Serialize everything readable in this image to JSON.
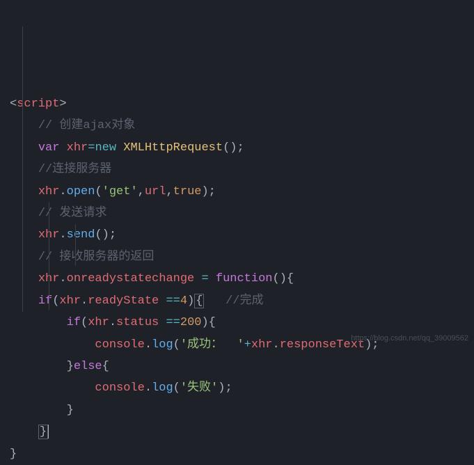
{
  "code": {
    "l1": {
      "open": "<",
      "tag": "script",
      "close": ">"
    },
    "l2": "// 创建ajax对象",
    "l3": {
      "kw": "var",
      "name": "xhr",
      "eq": "=",
      "new": "new",
      "cls": "XMLHttpRequest",
      "paren": "();"
    },
    "l4": "//连接服务器",
    "l5": {
      "obj": "xhr",
      "dot": ".",
      "m": "open",
      "p1": "(",
      "s1": "'get'",
      "c1": ",",
      "a2": "url",
      "c2": ",",
      "a3": "true",
      "p2": ");"
    },
    "l6": "// 发送请求",
    "l7": {
      "obj": "xhr",
      "dot": ".",
      "m": "send",
      "p": "();"
    },
    "l8": "// 接收服务器的返回",
    "l9": {
      "obj": "xhr",
      "dot": ".",
      "prop": "onreadystatechange",
      "sp1": " ",
      "eq": "=",
      "sp2": " ",
      "fn": "function",
      "p": "(){"
    },
    "l10": {
      "if": "if",
      "p1": "(",
      "obj": "xhr",
      "dot": ".",
      "prop": "readyState",
      "sp": " ",
      "eq": "==",
      "num": "4",
      "p2": ")",
      "brace": "{",
      "cmt": "   //完成"
    },
    "l11": {
      "if": "if",
      "p1": "(",
      "obj": "xhr",
      "dot": ".",
      "prop": "status",
      "sp": " ",
      "eq": "==",
      "num": "200",
      "p2": "){"
    },
    "l12": {
      "obj": "console",
      "dot": ".",
      "m": "log",
      "p1": "(",
      "s": "'成功：  '",
      "op": "+",
      "o2": "xhr",
      "d2": ".",
      "prop": "responseText",
      "p2": ");"
    },
    "l13": {
      "cb": "}",
      "else": "else",
      "ob": "{"
    },
    "l14": {
      "obj": "console",
      "dot": ".",
      "m": "log",
      "p1": "(",
      "s": "'失败'",
      "p2": ");"
    },
    "l15": "}",
    "l16": "}",
    "l17": "}"
  },
  "watermark": "https://blog.csdn.net/qq_39009562"
}
